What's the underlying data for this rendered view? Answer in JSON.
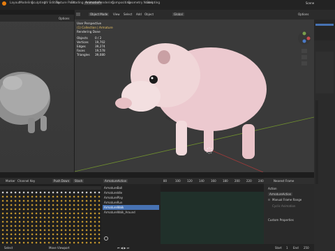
{
  "menu": {
    "tabs": [
      "Layout",
      "Modeling",
      "Sculpting",
      "UV Editing",
      "Texture Paint",
      "Shading",
      "Animation",
      "Rendering",
      "Compositing",
      "Geometry Nodes",
      "Scripting"
    ],
    "active": "Animation",
    "scene": "Scene"
  },
  "viewport": {
    "mode": "Object Mode",
    "menus": [
      "View",
      "Select",
      "Add",
      "Object"
    ],
    "orientation": "Global",
    "options": "Options",
    "left_options": "Options",
    "perspective": "User Perspective",
    "collection": "(1) Collection | Armature",
    "rendering": "Rendering Done",
    "stats": [
      {
        "label": "Objects",
        "value": "0 / 2"
      },
      {
        "label": "Vertices",
        "value": "19,702"
      },
      {
        "label": "Edges",
        "value": "39,274"
      },
      {
        "label": "Faces",
        "value": "19,578"
      },
      {
        "label": "Triangles",
        "value": "39,080"
      }
    ]
  },
  "timeline": {
    "menus": [
      "Marker",
      "Channel",
      "Key"
    ],
    "mode": "Push Down",
    "stash": "Stash",
    "action": "ArmatureAction",
    "frames": [
      "80",
      "100",
      "120",
      "140",
      "160",
      "180",
      "200",
      "220",
      "240"
    ]
  },
  "actions": {
    "items": [
      "ArmatureBall",
      "ArmatureIdle",
      "ArmaturePlay",
      "ArmatureRun",
      "ArmatureWalk",
      "ArmatureWalk_Around"
    ],
    "selected_index": 4
  },
  "panel": {
    "header": "Nearest Frame",
    "action_label": "Action",
    "action_value": "ArmatureAction",
    "manual_range": "Manual Frame Range",
    "cyclic": "Cyclic Animation",
    "custom": "Custom Properties"
  },
  "status": {
    "hint": "Move Viewport",
    "hint2": "Select",
    "start_label": "Start",
    "start": "1",
    "end_label": "End",
    "end": "250"
  },
  "colors": {
    "accent": "#4772b3",
    "active_tab": "#3d3d3d",
    "grid_red": "#a13a3a",
    "grid_green": "#6f8f2f",
    "keyframe": "#d0a030"
  }
}
